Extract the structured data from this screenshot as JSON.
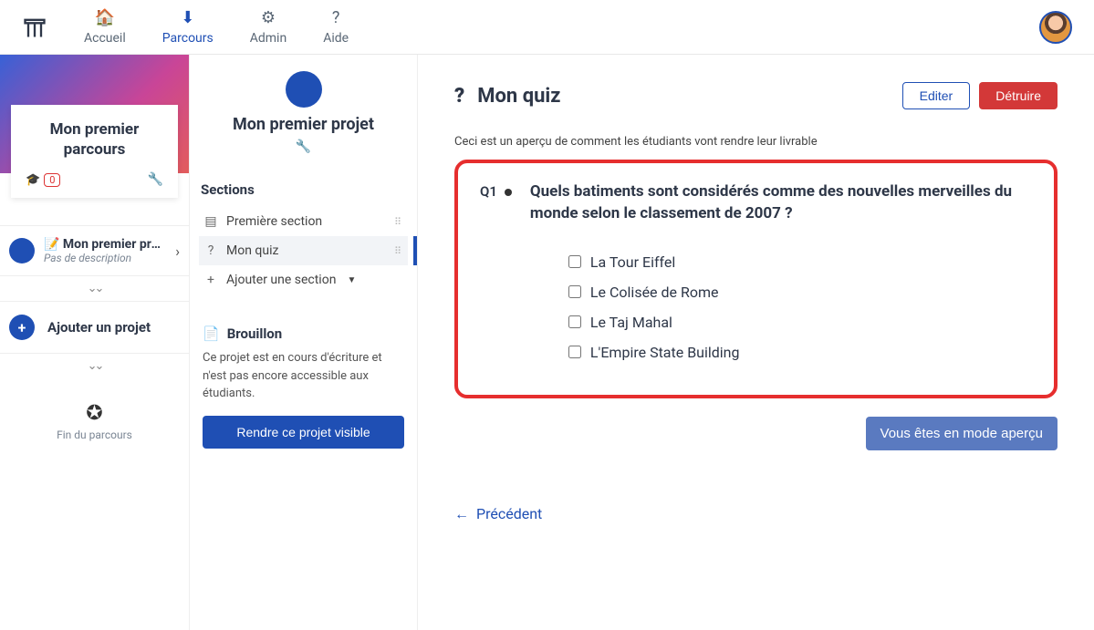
{
  "nav": {
    "accueil": "Accueil",
    "parcours": "Parcours",
    "admin": "Admin",
    "aide": "Aide"
  },
  "col1": {
    "parcours_title": "Mon premier parcours",
    "badge_count": "0",
    "project_name": "Mon premier pro...",
    "project_desc": "Pas de description",
    "add_project": "Ajouter un projet",
    "fin": "Fin du parcours"
  },
  "col2": {
    "project_title": "Mon premier projet",
    "sections_heading": "Sections",
    "section1": "Première section",
    "section2": "Mon quiz",
    "add_section": "Ajouter une section",
    "brouillon_title": "Brouillon",
    "brouillon_desc": "Ce projet est en cours d'écriture et n'est pas encore accessible aux étudiants.",
    "make_visible": "Rendre ce projet visible"
  },
  "page": {
    "title": "Mon quiz",
    "edit": "Editer",
    "destroy": "Détruire",
    "preview_note": "Ceci est un aperçu de comment les étudiants vont rendre leur livrable",
    "q_num": "Q1",
    "question": "Quels batiments sont considérés comme des nouvelles merveilles du monde selon le classement de 2007 ?",
    "options": {
      "a": "La Tour Eiffel",
      "b": "Le Colisée de Rome",
      "c": "Le Taj Mahal",
      "d": "L'Empire State Building"
    },
    "preview_mode": "Vous êtes en mode aperçu",
    "previous": "Précédent"
  }
}
